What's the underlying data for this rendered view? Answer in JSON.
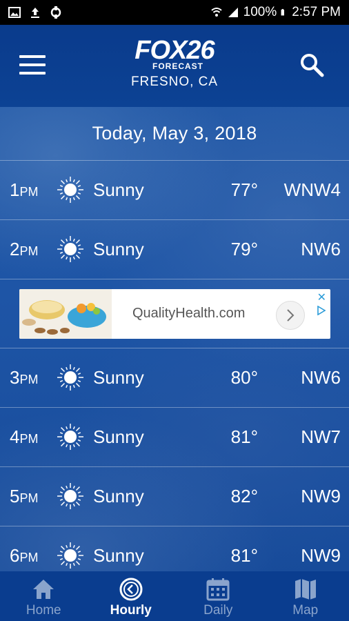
{
  "status_bar": {
    "battery": "100%",
    "time": "2:57 PM"
  },
  "header": {
    "logo_brand": "FOX26",
    "logo_sub": "FORECAST",
    "city": "FRESNO, CA"
  },
  "date_label": "Today, May 3, 2018",
  "hours": [
    {
      "hour": "1",
      "ampm": "PM",
      "condition": "Sunny",
      "temp": "77°",
      "wind": "WNW4"
    },
    {
      "hour": "2",
      "ampm": "PM",
      "condition": "Sunny",
      "temp": "79°",
      "wind": "NW6"
    },
    {
      "hour": "3",
      "ampm": "PM",
      "condition": "Sunny",
      "temp": "80°",
      "wind": "NW6"
    },
    {
      "hour": "4",
      "ampm": "PM",
      "condition": "Sunny",
      "temp": "81°",
      "wind": "NW7"
    },
    {
      "hour": "5",
      "ampm": "PM",
      "condition": "Sunny",
      "temp": "82°",
      "wind": "NW9"
    },
    {
      "hour": "6",
      "ampm": "PM",
      "condition": "Sunny",
      "temp": "81°",
      "wind": "NW9"
    }
  ],
  "ad": {
    "text": "QualityHealth.com"
  },
  "nav": [
    {
      "label": "Home",
      "icon": "home-icon",
      "active": false
    },
    {
      "label": "Hourly",
      "icon": "clock-icon",
      "active": true
    },
    {
      "label": "Daily",
      "icon": "calendar-icon",
      "active": false
    },
    {
      "label": "Map",
      "icon": "map-icon",
      "active": false
    }
  ],
  "colors": {
    "header_bg": "#0a3b8c",
    "content_bg": "#1e55a6",
    "nav_bg": "#0a3d8f",
    "nav_inactive": "#8aa4cc"
  }
}
